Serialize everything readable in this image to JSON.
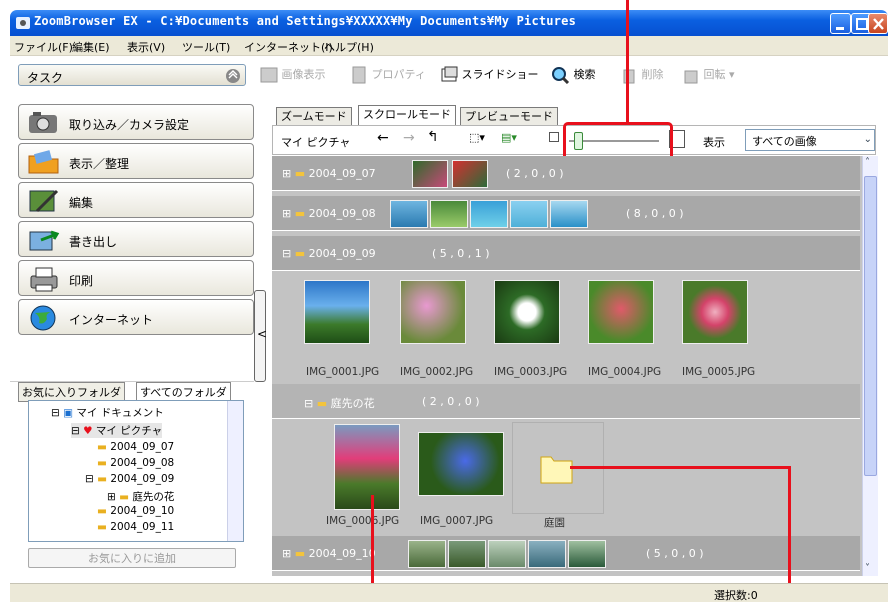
{
  "window": {
    "title": "ZoomBrowser EX  -  C:¥Documents and Settings¥XXXXX¥My Documents¥My Pictures"
  },
  "menu": [
    "ファイル(F)",
    "編集(E)",
    "表示(V)",
    "ツール(T)",
    "インターネット(I)",
    "ヘルプ(H)"
  ],
  "sidebar": {
    "task_label": "タスク",
    "tasks": [
      {
        "label": "取り込み／カメラ設定",
        "icon": "camera-icon"
      },
      {
        "label": "表示／整理",
        "icon": "folder-view-icon"
      },
      {
        "label": "編集",
        "icon": "edit-icon"
      },
      {
        "label": "書き出し",
        "icon": "export-icon"
      },
      {
        "label": "印刷",
        "icon": "printer-icon"
      },
      {
        "label": "インターネット",
        "icon": "globe-icon"
      }
    ],
    "folder_tabs": [
      "お気に入りフォルダ",
      "すべてのフォルダ"
    ],
    "tree": [
      "マイ ドキュメント",
      "マイ ピクチャ",
      "2004_09_07",
      "2004_09_08",
      "2004_09_09",
      "庭先の花",
      "2004_09_10",
      "2004_09_11"
    ],
    "add_favorite": "お気に入りに追加"
  },
  "toolbar": {
    "view": "画像表示",
    "properties": "プロパティ",
    "slideshow": "スライドショー",
    "search": "検索",
    "delete": "削除",
    "rotate": "回転"
  },
  "view_tabs": [
    "ズームモード",
    "スクロールモード",
    "プレビューモード"
  ],
  "subtoolbar": {
    "location": "マイ ピクチャ",
    "display_label": "表示",
    "filter": "すべての画像",
    "zoom_level": 0.06
  },
  "groups": [
    {
      "name": "2004_09_07",
      "counts": "( 2 , 0 , 0 )"
    },
    {
      "name": "2004_09_08",
      "counts": "( 8 , 0 , 0 )"
    },
    {
      "name": "2004_09_09",
      "counts": "( 5 , 0 , 1 )"
    },
    {
      "name": "庭先の花",
      "counts": "( 2 , 0 , 0 )"
    },
    {
      "name": "2004_09_10",
      "counts": "( 5 , 0 , 0 )"
    }
  ],
  "images_0909": [
    "IMG_0001.JPG",
    "IMG_0002.JPG",
    "IMG_0003.JPG",
    "IMG_0004.JPG",
    "IMG_0005.JPG"
  ],
  "images_garden": [
    "IMG_0006.JPG",
    "IMG_0007.JPG"
  ],
  "subfolder": "庭園",
  "status": {
    "selected": "選択数:0"
  },
  "colors": {
    "title_blue": "#0a5fe0",
    "annotation_red": "#e8101c",
    "group_gray": "#a8a8a8"
  }
}
